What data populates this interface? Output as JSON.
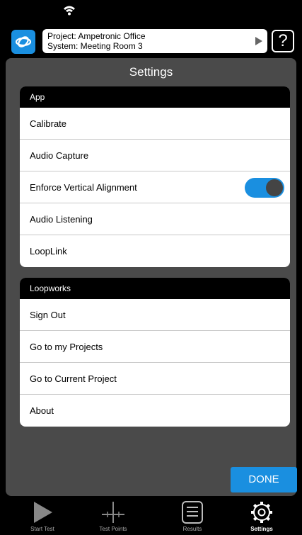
{
  "project": {
    "project_line": "Project: Ampetronic Office",
    "system_line": "System: Meeting Room 3"
  },
  "help_label": "?",
  "settings": {
    "title": "Settings",
    "app_group": {
      "header": "App",
      "items": [
        {
          "label": "Calibrate"
        },
        {
          "label": "Audio Capture"
        },
        {
          "label": "Enforce Vertical Alignment",
          "toggle_on": true
        },
        {
          "label": "Audio Listening"
        },
        {
          "label": "LoopLink"
        }
      ]
    },
    "loopworks_group": {
      "header": "Loopworks",
      "items": [
        {
          "label": "Sign Out"
        },
        {
          "label": "Go to my Projects"
        },
        {
          "label": "Go to Current Project"
        },
        {
          "label": "About"
        }
      ]
    },
    "done_label": "DONE"
  },
  "tabs": [
    {
      "label": "Start Test",
      "icon": "play-icon",
      "active": false
    },
    {
      "label": "Test Points",
      "icon": "crosshair-icon",
      "active": false
    },
    {
      "label": "Results",
      "icon": "list-icon",
      "active": false
    },
    {
      "label": "Settings",
      "icon": "gear-icon",
      "active": true
    }
  ],
  "colors": {
    "accent": "#1a8fe0",
    "panel": "#4a4a4a",
    "background": "#000000"
  }
}
